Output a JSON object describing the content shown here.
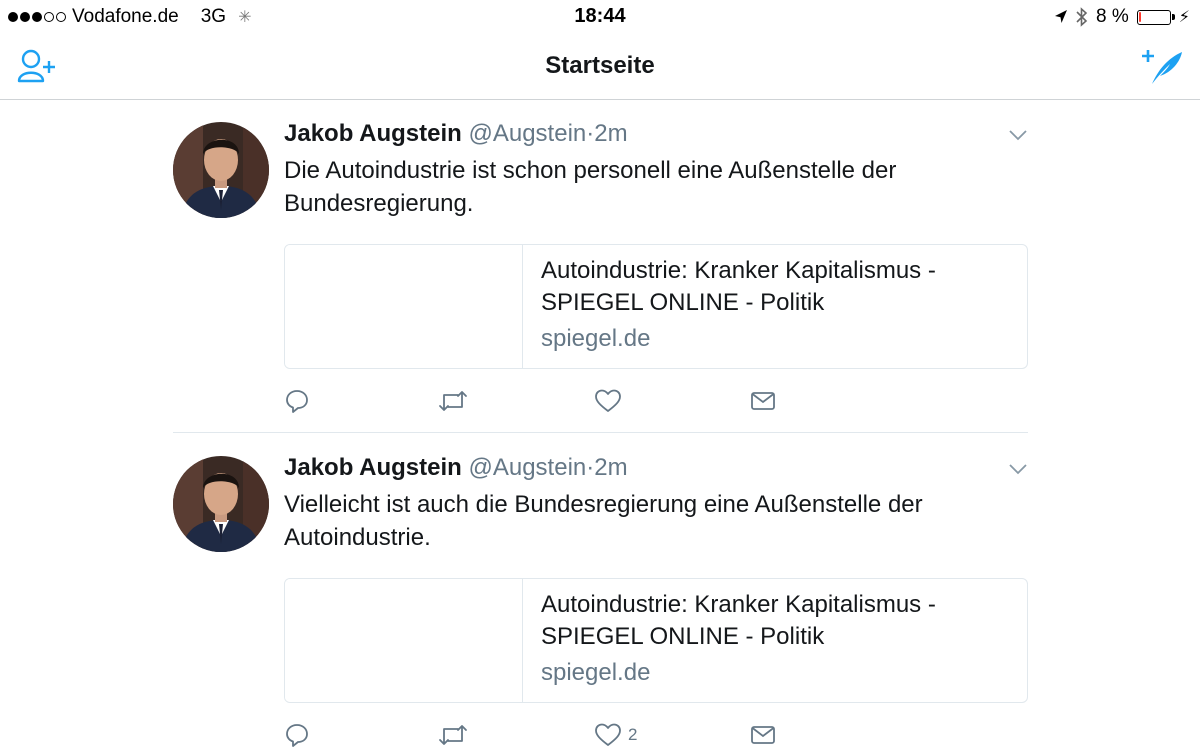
{
  "status_bar": {
    "carrier": "Vodafone.de",
    "network": "3G",
    "time": "18:44",
    "battery": "8 %",
    "battery_level": 0.08,
    "battery_color": "#ff3b30"
  },
  "nav": {
    "title": "Startseite",
    "left_icon": "add-user-icon",
    "right_icon": "compose-tweet-icon",
    "accent": "#1da1f2"
  },
  "tweets": [
    {
      "name": "Jakob Augstein",
      "handle": "@Augstein",
      "separator": "·",
      "time": "2m",
      "text": "Die Autoindustrie ist schon personell eine Außenstelle der Bundesregierung.",
      "card": {
        "title": "Autoindustrie: Kranker Kapitalismus - SPIEGEL ONLINE - Politik",
        "domain": "spiegel.de"
      },
      "likes": ""
    },
    {
      "name": "Jakob Augstein",
      "handle": "@Augstein",
      "separator": "·",
      "time": "2m",
      "text": "Vielleicht ist auch die Bundesregierung eine Außenstelle der Autoindustrie.",
      "card": {
        "title": "Autoindustrie: Kranker Kapitalismus - SPIEGEL ONLINE - Politik",
        "domain": "spiegel.de"
      },
      "likes": "2"
    }
  ]
}
